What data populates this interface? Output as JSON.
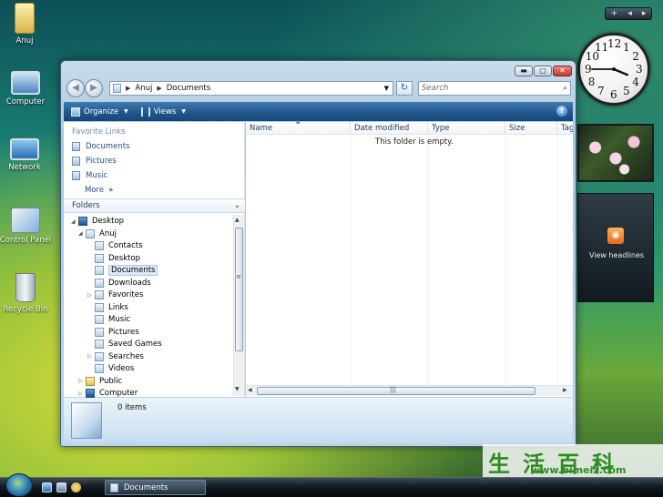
{
  "desktop": {
    "icons": [
      {
        "label": "Anuj",
        "icon": "user-folder-icon"
      },
      {
        "label": "Computer",
        "icon": "computer-icon"
      },
      {
        "label": "Network",
        "icon": "network-icon"
      },
      {
        "label": "Control Panel",
        "icon": "control-panel-icon"
      },
      {
        "label": "Recycle Bin",
        "icon": "recycle-bin-icon"
      }
    ]
  },
  "explorer": {
    "address": {
      "crumbs": [
        "Anuj",
        "Documents"
      ]
    },
    "search_placeholder": "Search",
    "toolbar": {
      "organize_label": "Organize",
      "views_label": "Views",
      "help_label": "?"
    },
    "favorite_links": {
      "title": "Favorite Links",
      "items": [
        "Documents",
        "Pictures",
        "Music"
      ],
      "more_label": "More"
    },
    "folders": {
      "title": "Folders",
      "tree": [
        {
          "label": "Desktop",
          "level": 0,
          "expander": "open",
          "icon": "desktop"
        },
        {
          "label": "Anuj",
          "level": 1,
          "expander": "open",
          "icon": "user"
        },
        {
          "label": "Contacts",
          "level": 2,
          "expander": "",
          "icon": "special"
        },
        {
          "label": "Desktop",
          "level": 2,
          "expander": "",
          "icon": "special"
        },
        {
          "label": "Documents",
          "level": 2,
          "expander": "",
          "icon": "special",
          "selected": true
        },
        {
          "label": "Downloads",
          "level": 2,
          "expander": "",
          "icon": "special"
        },
        {
          "label": "Favorites",
          "level": 2,
          "expander": "closed",
          "icon": "special"
        },
        {
          "label": "Links",
          "level": 2,
          "expander": "",
          "icon": "special"
        },
        {
          "label": "Music",
          "level": 2,
          "expander": "",
          "icon": "special"
        },
        {
          "label": "Pictures",
          "level": 2,
          "expander": "",
          "icon": "special"
        },
        {
          "label": "Saved Games",
          "level": 2,
          "expander": "",
          "icon": "special"
        },
        {
          "label": "Searches",
          "level": 2,
          "expander": "closed",
          "icon": "special"
        },
        {
          "label": "Videos",
          "level": 2,
          "expander": "",
          "icon": "special"
        },
        {
          "label": "Public",
          "level": 1,
          "expander": "closed",
          "icon": "folder"
        },
        {
          "label": "Computer",
          "level": 1,
          "expander": "closed",
          "icon": "computer"
        }
      ]
    },
    "columns": [
      "Name",
      "Date modified",
      "Type",
      "Size",
      "Tag"
    ],
    "empty_message": "This folder is empty.",
    "details": {
      "item_count": "0 items"
    }
  },
  "sidebar": {
    "controls": [
      "+",
      "◂",
      "▸"
    ],
    "clock_numbers": [
      "12",
      "1",
      "2",
      "3",
      "4",
      "5",
      "6",
      "7",
      "8",
      "9",
      "10",
      "11"
    ],
    "clock_time": {
      "hour": 3,
      "minute": 45
    },
    "feed_label": "View headlines"
  },
  "watermark": {
    "text": "生活百科",
    "url": "www.bimeiz.com"
  },
  "taskbar": {
    "active_window": "Documents"
  }
}
